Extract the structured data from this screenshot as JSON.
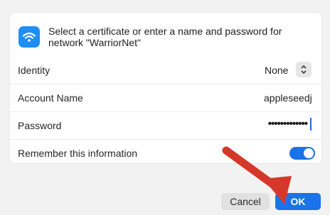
{
  "header": {
    "message": "Select a certificate or enter a name and password for network \"WarriorNet\"",
    "icon": "wifi-icon"
  },
  "fields": {
    "identity": {
      "label": "Identity",
      "value": "None"
    },
    "account_name": {
      "label": "Account Name",
      "value": "appleseedj"
    },
    "password": {
      "label": "Password",
      "masked_value": "•••••••••••••"
    },
    "remember": {
      "label": "Remember this information",
      "enabled": true
    }
  },
  "buttons": {
    "cancel": "Cancel",
    "ok": "OK"
  },
  "colors": {
    "accent": "#1a73e8",
    "wifi_badge": "#1d8ef5",
    "arrow": "#d5372b"
  }
}
